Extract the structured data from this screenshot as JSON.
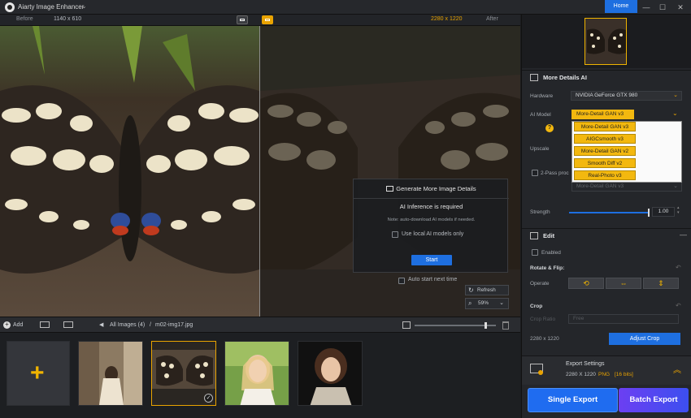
{
  "app": {
    "title": "Aiarty Image Enhancer",
    "home_label": "Home"
  },
  "compare": {
    "before_label": "Before",
    "before_size": "1140 x 610",
    "after_size": "2280 x 1220",
    "after_label": "After"
  },
  "dialog": {
    "title": "Generate More Image Details",
    "subtitle": "AI Inference is required",
    "note": "Note: auto-download AI models if needed.",
    "local_models_label": "Use local AI models only",
    "start_label": "Start",
    "auto_start_label": "Auto start next time"
  },
  "view_controls": {
    "refresh_label": "Refresh",
    "zoom_value": "59%"
  },
  "toolbar": {
    "add_label": "Add",
    "all_images_label": "All Images (4)",
    "separator": "/",
    "current_file": "m02-img17.jpg"
  },
  "panel": {
    "section_title": "More Details AI",
    "hardware_label": "Hardware",
    "hardware_value": "NVIDIA GeForce GTX 980",
    "ai_model_label": "AI Model",
    "ai_model_value": "More-Detail GAN  v3",
    "model_options": [
      "More-Detail GAN  v3",
      "AIGCsmooth  v3",
      "More-Detail GAN  v2",
      "Smooth Diff  v2",
      "Real-Photo  v3"
    ],
    "upscale_label": "Upscale",
    "two_pass_label": "2-Pass proc",
    "second_pass_value": "More-Detail GAN  v3",
    "strength_label": "Strength",
    "strength_value": "1.00",
    "edit_title": "Edit",
    "enabled_label": "Enabled",
    "rotate_flip_label": "Rotate & Flip:",
    "operate_label": "Operate",
    "crop_label": "Crop",
    "crop_ratio_label": "Crop Ratio",
    "crop_ratio_value": "Free",
    "crop_size": "2280 x 1220",
    "adjust_crop_label": "Adjust Crop",
    "export_settings_label": "Export Settings",
    "export_size": "2280 X 1220",
    "export_format": "PNG",
    "export_bits": "[16 bits]",
    "single_export_label": "Single Export",
    "batch_export_label": "Batch Export"
  },
  "colors": {
    "accent": "#e9a300",
    "primary": "#1e6fe0",
    "model_yellow": "#f3b80f"
  }
}
